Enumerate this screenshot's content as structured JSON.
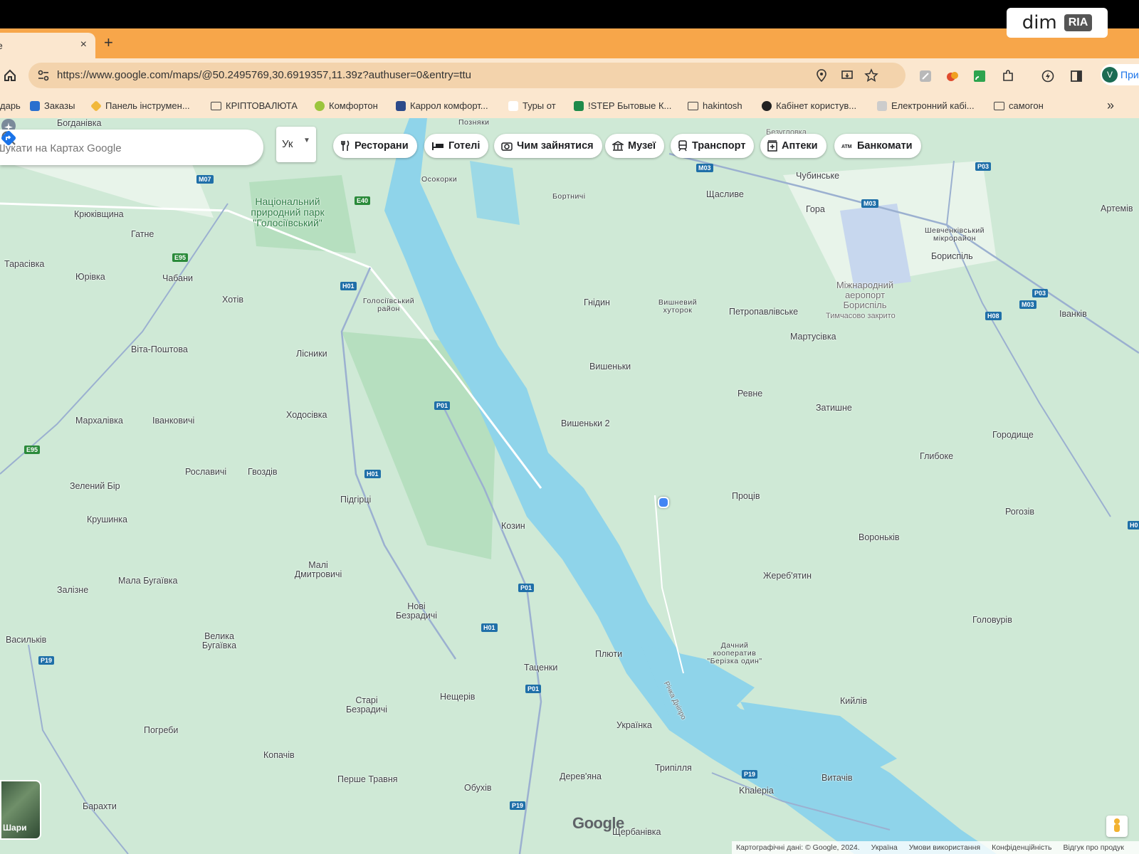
{
  "watermark": {
    "text": "dim",
    "logo": "RIA"
  },
  "tab": {
    "title": "e",
    "close": "×",
    "new_tab": "+"
  },
  "toolbar": {
    "url": "https://www.google.com/maps/@50.2495769,30.6919357,11.39z?authuser=0&entry=ttu",
    "profile_initial": "V",
    "profile_label": "При"
  },
  "bookmarks": [
    {
      "label": "дарь"
    },
    {
      "label": "Заказы"
    },
    {
      "label": "Панель інструмен..."
    },
    {
      "label": "КРІПТОВАЛЮТА"
    },
    {
      "label": "Комфортон"
    },
    {
      "label": "Каррол комфорт..."
    },
    {
      "label": "Туры от"
    },
    {
      "label": "!STEP Бытовые К..."
    },
    {
      "label": "hakintosh"
    },
    {
      "label": "Кабінет користув..."
    },
    {
      "label": "Електронний кабі..."
    },
    {
      "label": "самогон"
    }
  ],
  "bookmarks_more": "»",
  "search": {
    "placeholder": "Шукати на Картах Google"
  },
  "language": {
    "label": "Ук"
  },
  "chips": [
    {
      "label": "Ресторани",
      "icon": "fork-knife-icon"
    },
    {
      "label": "Готелі",
      "icon": "bed-icon"
    },
    {
      "label": "Чим зайнятися",
      "icon": "camera-icon"
    },
    {
      "label": "Музеї",
      "icon": "museum-icon"
    },
    {
      "label": "Транспорт",
      "icon": "train-icon"
    },
    {
      "label": "Аптеки",
      "icon": "pharmacy-icon"
    },
    {
      "label": "Банкомати",
      "icon": "atm-icon"
    }
  ],
  "map_labels": [
    "Крюківщина",
    "Гатне",
    "Тарасівка",
    "Юрівка",
    "Чабани",
    "Хотів",
    "Віта-Поштова",
    "Лісники",
    "Мархалівка",
    "Іванковичі",
    "Ходосівка",
    "Рославичі",
    "Гвоздів",
    "Зелений Бір",
    "Крушинка",
    "Підгірці",
    "Козин",
    "Малі Дмитровичі",
    "Мала Бугаївка",
    "Залізне",
    "Нові Безрадичі",
    "Васильків",
    "Велика Бугаївка",
    "Таценки",
    "Плюти",
    "Старі Безрадичі",
    "Нещерів",
    "Погреби",
    "Копачів",
    "Українка",
    "Перше Травня",
    "Обухів",
    "Дерев'яна",
    "Трипілля",
    "Барахти",
    "Khalepia",
    "Щербанівка",
    "Витачів",
    "Кийлів",
    "Головурів",
    "Жереб'ятин",
    "Вороньків",
    "Процiв",
    "Рогозів",
    "Глибоке",
    "Городище",
    "Затишне",
    "Ревне",
    "Мартусівка",
    "Петропавлівське",
    "Вишеньки",
    "Вишеньки 2",
    "Гнідин",
    "Чубинське",
    "Щасливе",
    "Гора",
    "Бориспіль",
    "Іванків",
    "Артемів",
    "Безугловка",
    "Позняки",
    "Осокорки",
    "Бортничі",
    "Вишневий хуторок",
    "Голосіївський район",
    "Шевченківський мікрорайон",
    "Дачний кооператив \"Берізка один\"",
    "Річка Дніпро",
    "Богданівка"
  ],
  "park_label": "Національний природний парк \"Голосіївський\"",
  "airport": {
    "name": "Міжнародний аеропорт Бориспіль",
    "status": "Тимчасово закрито"
  },
  "road_shields": [
    "M07",
    "E40",
    "E95",
    "H01",
    "P01",
    "E95",
    "P19",
    "P01",
    "H01",
    "P01",
    "H01",
    "P19",
    "P19",
    "M03",
    "M03",
    "P03",
    "P03",
    "M03",
    "H08",
    "H0"
  ],
  "satellite": {
    "label": "Шари"
  },
  "google_logo": "Google",
  "attribution": [
    "Картографічні дані: © Google, 2024.",
    "Україна",
    "Умови використання",
    "Конфіденційність",
    "Відгук про продук"
  ]
}
